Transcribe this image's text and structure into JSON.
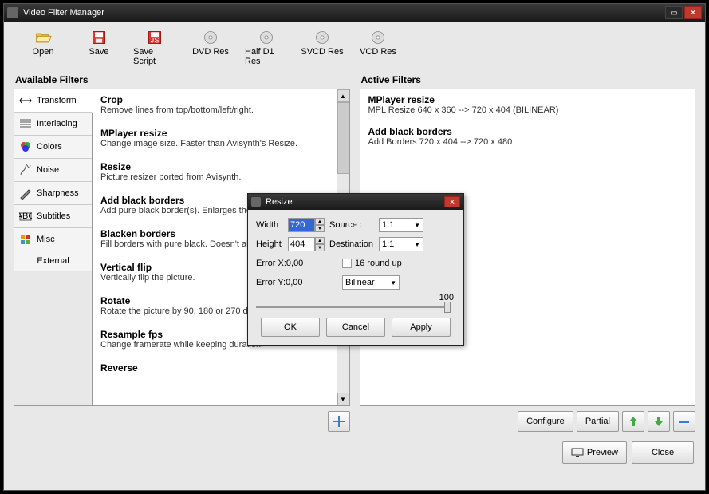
{
  "window": {
    "title": "Video Filter Manager"
  },
  "toolbar": [
    {
      "id": "open",
      "label": "Open"
    },
    {
      "id": "save",
      "label": "Save"
    },
    {
      "id": "save-script",
      "label": "Save Script"
    },
    {
      "id": "dvd-res",
      "label": "DVD Res"
    },
    {
      "id": "half-d1-res",
      "label": "Half D1 Res"
    },
    {
      "id": "svcd-res",
      "label": "SVCD Res"
    },
    {
      "id": "vcd-res",
      "label": "VCD Res"
    }
  ],
  "available_header": "Available Filters",
  "active_header": "Active Filters",
  "tabs": [
    {
      "id": "transform",
      "label": "Transform"
    },
    {
      "id": "interlacing",
      "label": "Interlacing"
    },
    {
      "id": "colors",
      "label": "Colors"
    },
    {
      "id": "noise",
      "label": "Noise"
    },
    {
      "id": "sharpness",
      "label": "Sharpness"
    },
    {
      "id": "subtitles",
      "label": "Subtitles"
    },
    {
      "id": "misc",
      "label": "Misc"
    },
    {
      "id": "external",
      "label": "External"
    }
  ],
  "filters": [
    {
      "title": "Crop",
      "desc": "Remove lines from top/bottom/left/right."
    },
    {
      "title": "MPlayer resize",
      "desc": "Change image size. Faster than Avisynth's Resize."
    },
    {
      "title": "Resize",
      "desc": "Picture resizer ported from Avisynth."
    },
    {
      "title": "Add black borders",
      "desc": "Add pure black border(s). Enlarges the picture."
    },
    {
      "title": "Blacken borders",
      "desc": "Fill borders with pure black. Doesn't alter size."
    },
    {
      "title": "Vertical flip",
      "desc": "Vertically flip the picture."
    },
    {
      "title": "Rotate",
      "desc": "Rotate the picture by 90, 180 or 270 degrees."
    },
    {
      "title": "Resample fps",
      "desc": "Change framerate while keeping duration."
    },
    {
      "title": "Reverse",
      "desc": ""
    }
  ],
  "active_filters": [
    {
      "title": "MPlayer resize",
      "desc": "MPL Resize 640 x 360 --> 720 x 404 (BILINEAR)"
    },
    {
      "title": "Add black borders",
      "desc": "Add Borders 720 x 404 --> 720 x 480"
    }
  ],
  "active_buttons": {
    "configure": "Configure",
    "partial": "Partial"
  },
  "footer": {
    "preview": "Preview",
    "close": "Close"
  },
  "dialog": {
    "title": "Resize",
    "width_label": "Width",
    "width_value": "720",
    "height_label": "Height",
    "height_value": "404",
    "source_label": "Source :",
    "source_value": "1:1",
    "dest_label": "Destination",
    "dest_value": "1:1",
    "errx": "Error X:0,00",
    "erry": "Error Y:0,00",
    "roundup": "16 round up",
    "algo": "Bilinear",
    "slider_value": "100",
    "ok": "OK",
    "cancel": "Cancel",
    "apply": "Apply"
  }
}
